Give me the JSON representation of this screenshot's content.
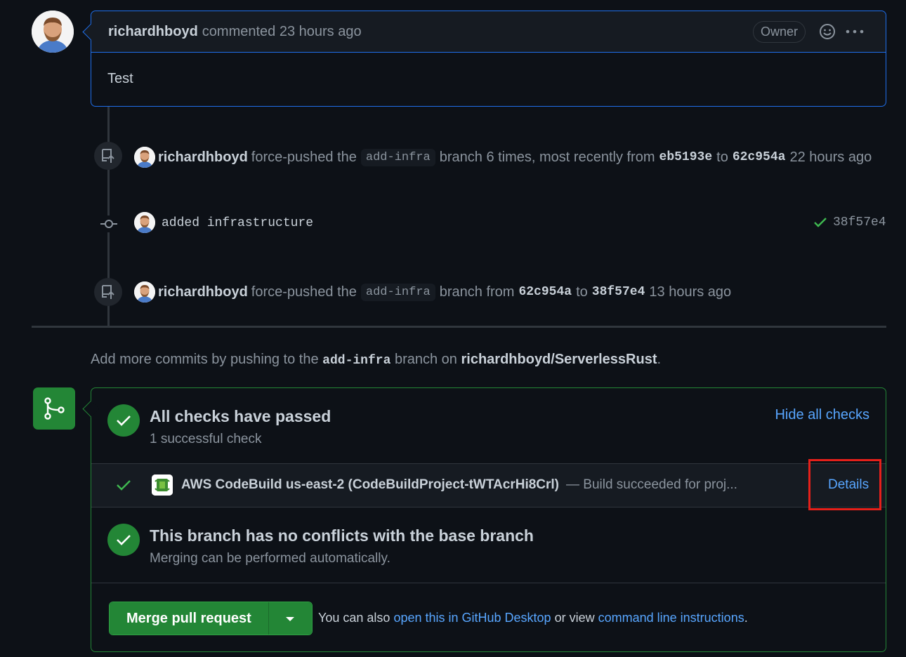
{
  "comment": {
    "author": "richardhboyd",
    "action": "commented 23 hours ago",
    "badge": "Owner",
    "body": "Test"
  },
  "timeline": {
    "event1": {
      "author": "richardhboyd",
      "pre": "force-pushed the",
      "branch": "add-infra",
      "mid": "branch 6 times, most recently from",
      "from_sha": "eb5193e",
      "to_word": "to",
      "to_sha": "62c954a",
      "time": "22 hours ago"
    },
    "commit": {
      "message": "added infrastructure",
      "sha": "38f57e4"
    },
    "event2": {
      "author": "richardhboyd",
      "pre": "force-pushed the",
      "branch": "add-infra",
      "mid": "branch from",
      "from_sha": "62c954a",
      "to_word": "to",
      "to_sha": "38f57e4",
      "time": "13 hours ago"
    }
  },
  "hint": {
    "pre": "Add more commits by pushing to the",
    "branch": "add-infra",
    "mid": "branch on",
    "repo": "richardhboyd/ServerlessRust",
    "end": "."
  },
  "merge_box": {
    "checks_title": "All checks have passed",
    "checks_sub": "1 successful check",
    "hide_checks": "Hide all checks",
    "check": {
      "name": "AWS CodeBuild us-east-2 (CodeBuildProject-tWTAcrHi8Crl)",
      "desc": "— Build succeeded for proj...",
      "details": "Details"
    },
    "conflicts_title": "This branch has no conflicts with the base branch",
    "conflicts_sub": "Merging can be performed automatically.",
    "merge_button": "Merge pull request",
    "footer": {
      "pre": "You can also",
      "link1": "open this in GitHub Desktop",
      "mid": "or view",
      "link2": "command line instructions",
      "end": "."
    }
  },
  "colors": {
    "accent_blue": "#1f6feb",
    "link": "#58a6ff",
    "success": "#238636",
    "highlight": "#e5201a"
  }
}
